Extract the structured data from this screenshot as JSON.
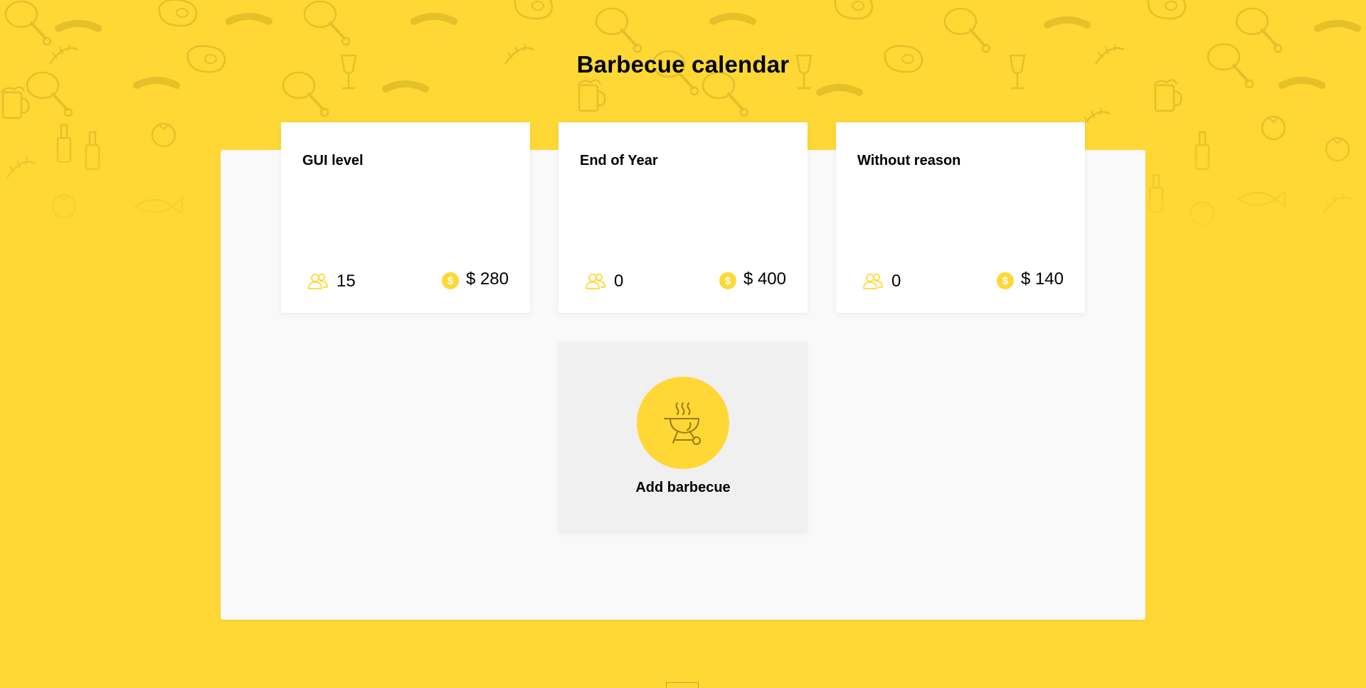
{
  "page": {
    "title": "Barbecue calendar",
    "background_color": "#FFD836",
    "accent_color": "#FFD836"
  },
  "cards": [
    {
      "title": "GUI level",
      "people": "15",
      "price": "$ 280"
    },
    {
      "title": "End of Year",
      "people": "0",
      "price": "$ 400"
    },
    {
      "title": "Without reason",
      "people": "0",
      "price": "$ 140"
    }
  ],
  "add_card": {
    "label": "Add barbecue",
    "icon": "barbecue-grill-icon"
  },
  "icons": {
    "people": "people-icon",
    "money": "dollar-coin-icon",
    "coin_glyph": "$"
  }
}
